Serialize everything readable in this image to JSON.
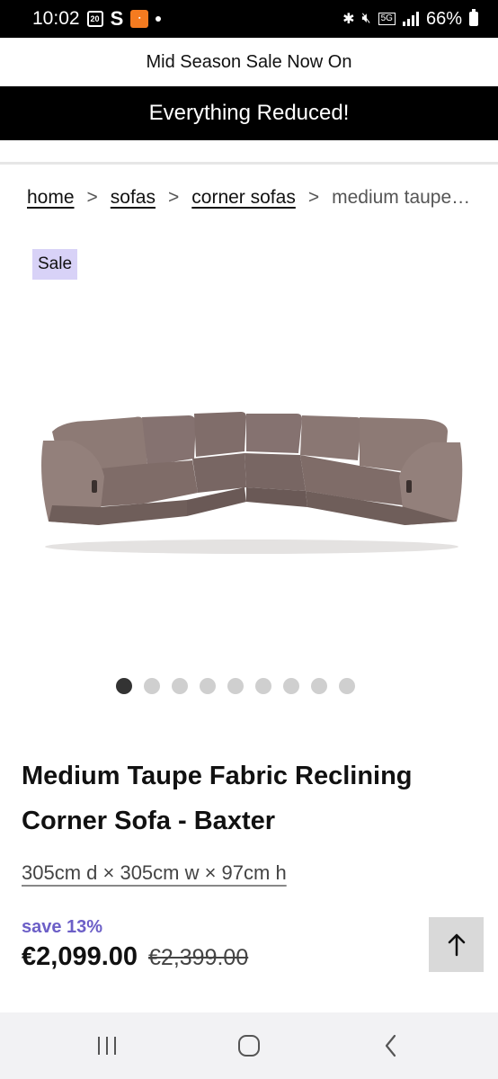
{
  "status_bar": {
    "time": "10:02",
    "calendar_day": "20",
    "s_label": "S",
    "battery": "66%",
    "network": "5G"
  },
  "promo": {
    "top_text": "Mid Season Sale Now On",
    "banner_text": "Everything Reduced!"
  },
  "breadcrumb": {
    "items": [
      "home",
      "sofas",
      "corner sofas"
    ],
    "separator": ">",
    "current": "medium taupe…"
  },
  "badge": {
    "sale": "Sale"
  },
  "product": {
    "image_alt": "sofa-image",
    "title": "Medium Taupe Fabric Reclining Corner Sofa - Baxter",
    "dimensions": "305cm d × 305cm w × 97cm h",
    "save": "save 13%",
    "price_now": "€2,099.00",
    "price_was": "€2,399.00"
  },
  "carousel": {
    "count": 9,
    "active_index": 0
  },
  "colors": {
    "accent_purple": "#6c5fc7",
    "badge_bg": "#d8d2f7",
    "sofa_fabric": "#8a7772"
  },
  "icons": {
    "back_to_top": "arrow-up-icon",
    "nav_recent": "recent-apps-icon",
    "nav_home": "home-icon",
    "nav_back": "back-icon"
  }
}
